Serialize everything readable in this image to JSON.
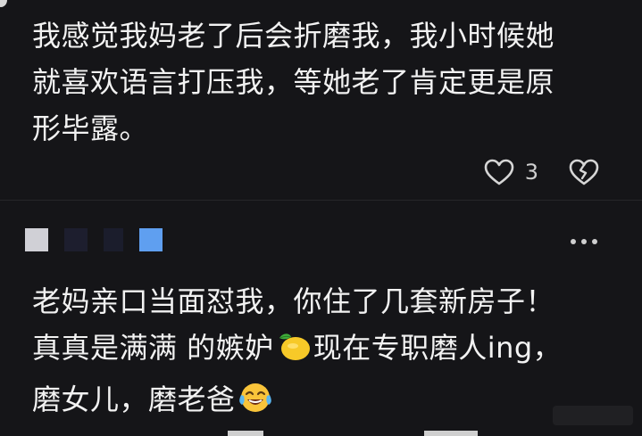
{
  "comment1": {
    "line1": "我感觉我妈老了后会折磨我，我小时候她",
    "line2": "就喜欢语言打压我，等她老了肯定更是原",
    "line3": "形毕露。",
    "like_count": "3"
  },
  "comment2": {
    "line1": "老妈亲口当面怼我，你住了几套新房子！",
    "line2_a": "真真是满满 的嫉妒",
    "line2_b": "现在专职磨人ing，",
    "line3": "磨女儿，磨老爸"
  },
  "icons": {
    "like": "heart-icon",
    "dislike": "broken-heart-icon",
    "more": "more-dots-icon",
    "lemon": "lemon-emoji",
    "crying": "crying-laughing-emoji"
  }
}
